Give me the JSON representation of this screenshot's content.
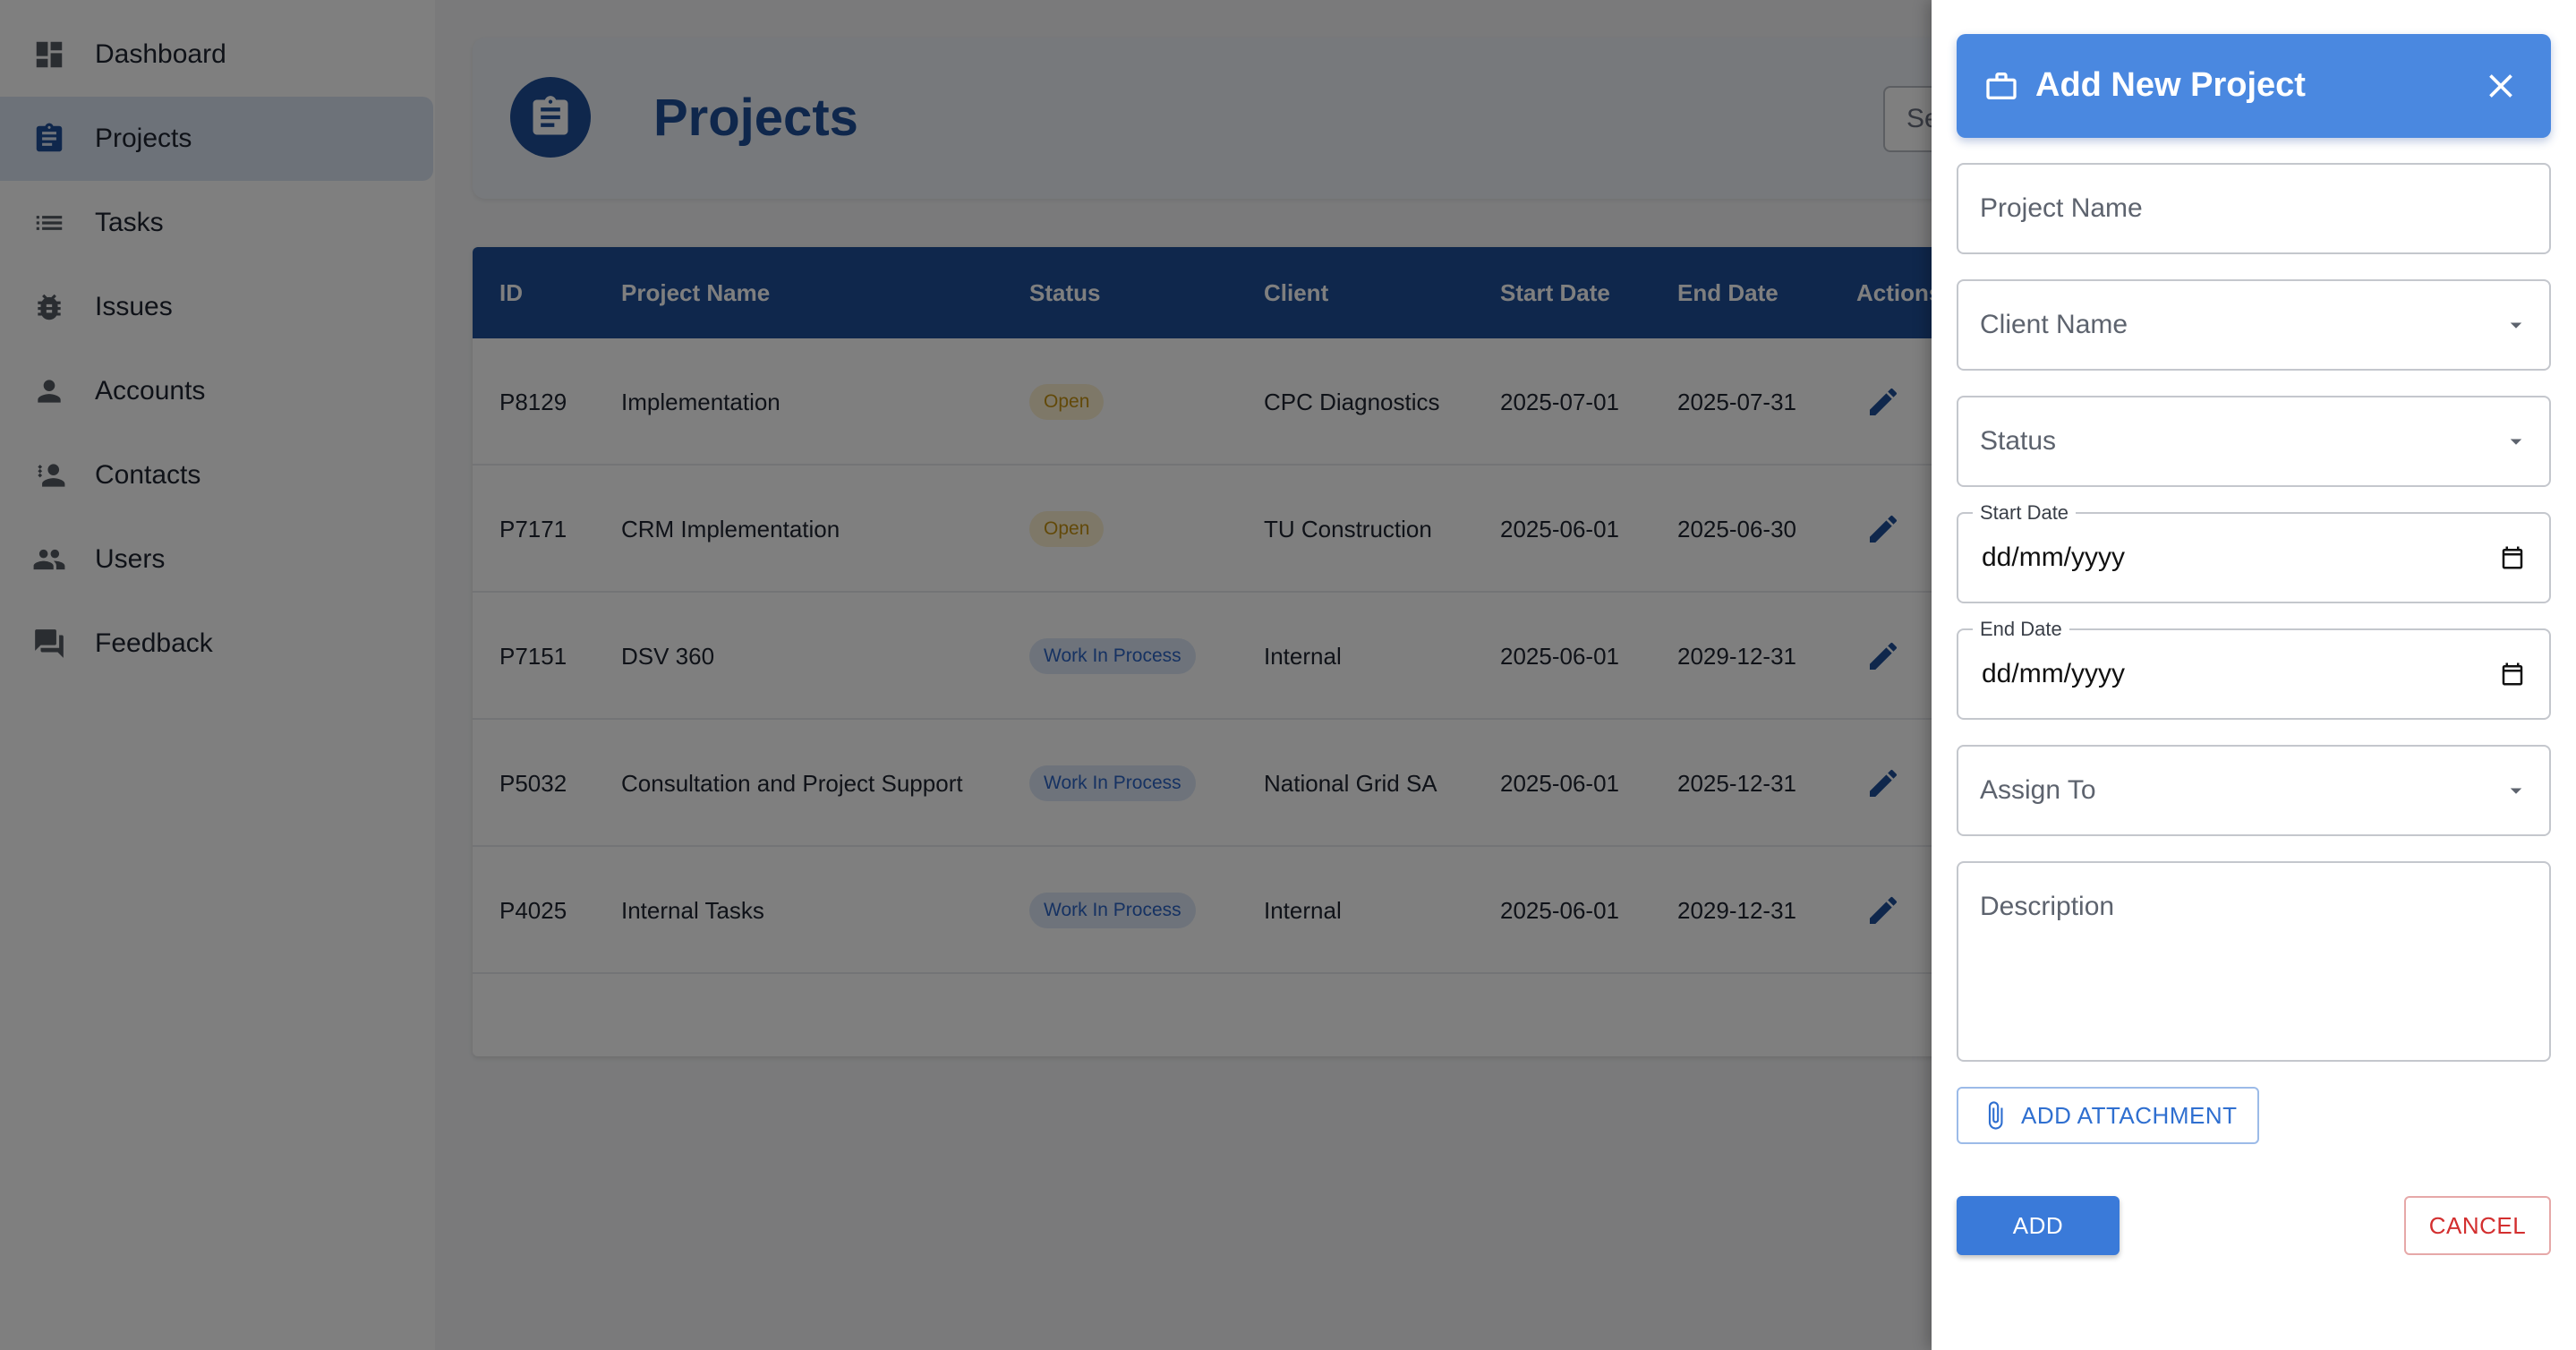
{
  "sidebar": {
    "items": [
      {
        "label": "Dashboard",
        "icon": "dashboard-icon"
      },
      {
        "label": "Projects",
        "icon": "clipboard-icon",
        "active": true
      },
      {
        "label": "Tasks",
        "icon": "list-icon"
      },
      {
        "label": "Issues",
        "icon": "bug-icon"
      },
      {
        "label": "Accounts",
        "icon": "person-icon"
      },
      {
        "label": "Contacts",
        "icon": "contacts-icon"
      },
      {
        "label": "Users",
        "icon": "people-icon"
      },
      {
        "label": "Feedback",
        "icon": "feedback-icon"
      }
    ]
  },
  "header": {
    "title": "Projects",
    "search_text": "Searc"
  },
  "table": {
    "columns": [
      "ID",
      "Project Name",
      "Status",
      "Client",
      "Start Date",
      "End Date",
      "Actions"
    ],
    "rows": [
      {
        "id": "P8129",
        "name": "Implementation",
        "status": "Open",
        "client": "CPC Diagnostics",
        "start": "2025-07-01",
        "end": "2025-07-31"
      },
      {
        "id": "P7171",
        "name": "CRM Implementation",
        "status": "Open",
        "client": "TU Construction",
        "start": "2025-06-01",
        "end": "2025-06-30"
      },
      {
        "id": "P7151",
        "name": "DSV 360",
        "status": "Work In Process",
        "client": "Internal",
        "start": "2025-06-01",
        "end": "2029-12-31"
      },
      {
        "id": "P5032",
        "name": "Consultation and Project Support",
        "status": "Work In Process",
        "client": "National Grid SA",
        "start": "2025-06-01",
        "end": "2025-12-31"
      },
      {
        "id": "P4025",
        "name": "Internal Tasks",
        "status": "Work In Process",
        "client": "Internal",
        "start": "2025-06-01",
        "end": "2029-12-31"
      }
    ]
  },
  "drawer": {
    "title": "Add New Project",
    "fields": {
      "project_name": "Project Name",
      "client_name": "Client Name",
      "status": "Status",
      "start_date_label": "Start Date",
      "start_date_value": "dd/mm/yyyy",
      "end_date_label": "End Date",
      "end_date_value": "dd/mm/yyyy",
      "assign_to": "Assign To",
      "description": "Description"
    },
    "attach_label": "ADD ATTACHMENT",
    "add_label": "ADD",
    "cancel_label": "CANCEL"
  },
  "colors": {
    "primary": "#1e4f99",
    "drawer_header": "#4a88e0",
    "open_chip": "#c59213",
    "wip_chip": "#2c64c4",
    "cancel": "#d32f2f"
  }
}
